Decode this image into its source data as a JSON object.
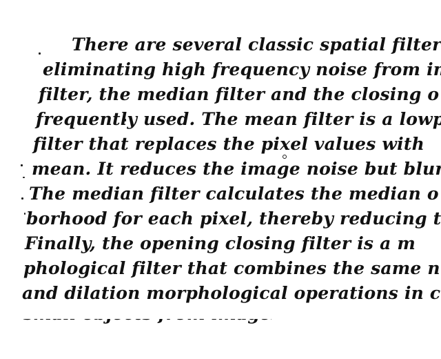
{
  "document": {
    "lines": [
      "There are several classic spatial filters",
      "eliminating high frequency noise from im",
      "filter, the median filter and the closing o",
      "frequently used. The mean filter is a lowp",
      "filter that replaces the pixel values with",
      "mean. It reduces the image noise but blurs",
      "The median filter calculates the median o",
      "borhood for each pixel, thereby reducing th",
      "Finally, the opening closing filter is a m",
      "phological filter that combines the same n",
      "and dilation morphological operations in c"
    ],
    "cutoff_line": "small objects from images."
  }
}
